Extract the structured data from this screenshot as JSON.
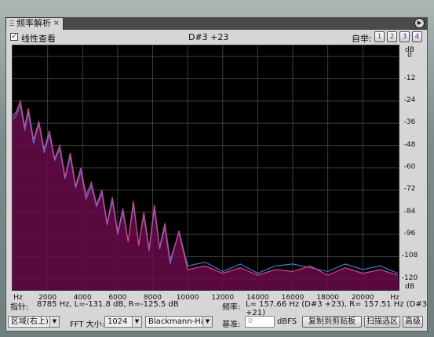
{
  "panel": {
    "tab_title": "频率解析",
    "close_glyph": "×",
    "menu_glyph": "▶"
  },
  "toolbar": {
    "linear_view_label": "线性查看",
    "linear_view_checked": true,
    "note_readout": "D#3 +23",
    "custom_label": "自举:",
    "presets": [
      "1",
      "2",
      "3",
      "4"
    ]
  },
  "chart_data": {
    "type": "area",
    "xlabel": "Hz",
    "ylabel": "dB",
    "xlim": [
      0,
      22050
    ],
    "ylim": [
      -126,
      6
    ],
    "x_ticks": [
      "Hz",
      "2000",
      "4000",
      "6000",
      "8000",
      "10000",
      "12000",
      "14000",
      "16000",
      "18000",
      "20000",
      "Hz"
    ],
    "y_ticks": [
      "dB",
      "0",
      "-12",
      "-24",
      "-36",
      "-48",
      "-60",
      "-72",
      "-84",
      "-96",
      "-108",
      "-120",
      "dB"
    ],
    "grid": true,
    "series": [
      {
        "color": "#e0408a",
        "x": [
          0,
          200,
          450,
          700,
          900,
          1200,
          1500,
          1800,
          2100,
          2400,
          2700,
          3000,
          3300,
          3600,
          3900,
          4200,
          4500,
          4800,
          5100,
          5400,
          5700,
          6000,
          6300,
          6600,
          6900,
          7200,
          7500,
          7800,
          8100,
          8400,
          8700,
          9000,
          9500,
          10000,
          11000,
          12000,
          13000,
          14000,
          15000,
          16000,
          17000,
          18000,
          19000,
          20000,
          21000,
          22000
        ],
        "values": [
          -32,
          -30,
          -24,
          -38,
          -28,
          -45,
          -35,
          -50,
          -40,
          -55,
          -48,
          -65,
          -52,
          -70,
          -60,
          -75,
          -68,
          -80,
          -72,
          -90,
          -76,
          -95,
          -82,
          -100,
          -78,
          -102,
          -84,
          -104,
          -80,
          -103,
          -90,
          -110,
          -95,
          -115,
          -113,
          -117,
          -114,
          -118,
          -115,
          -116,
          -113,
          -118,
          -114,
          -117,
          -115,
          -118
        ]
      },
      {
        "color": "#3a7bd5",
        "x": [
          0,
          200,
          450,
          700,
          900,
          1200,
          1500,
          1800,
          2100,
          2400,
          2700,
          3000,
          3300,
          3600,
          3900,
          4200,
          4500,
          4800,
          5100,
          5400,
          5700,
          6000,
          6300,
          6600,
          6900,
          7200,
          7500,
          7800,
          8100,
          8400,
          8700,
          9000,
          9500,
          10000,
          11000,
          12000,
          13000,
          14000,
          15000,
          16000,
          17000,
          18000,
          19000,
          20000,
          21000,
          22000
        ],
        "values": [
          -34,
          -32,
          -26,
          -40,
          -30,
          -47,
          -36,
          -52,
          -42,
          -56,
          -50,
          -66,
          -54,
          -71,
          -62,
          -77,
          -70,
          -81,
          -74,
          -91,
          -78,
          -96,
          -84,
          -100,
          -80,
          -101,
          -86,
          -105,
          -82,
          -104,
          -92,
          -112,
          -94,
          -113,
          -111,
          -116,
          -112,
          -117,
          -113,
          -112,
          -114,
          -116,
          -112,
          -115,
          -113,
          -117
        ]
      }
    ]
  },
  "status": {
    "cursor_label": "指针:",
    "cursor_value": "8785 Hz, L=-131.8 dB, R=-125.5 dB",
    "freq_label": "频率:",
    "freq_value": "L= 157.66 Hz (D#3 +23), R= 157.51 Hz (D#3 +21)"
  },
  "controls": {
    "range_select": "区域(右上)",
    "fft_label": "FFT 大小:",
    "fft_value": "1024",
    "window_value": "Blackmann-Harris",
    "reference_label": "基准:",
    "reference_value": "0",
    "reference_unit": "dBFS",
    "copy_button": "复制到剪贴板",
    "scan_button": "扫描选区",
    "advanced_button": "高级"
  }
}
